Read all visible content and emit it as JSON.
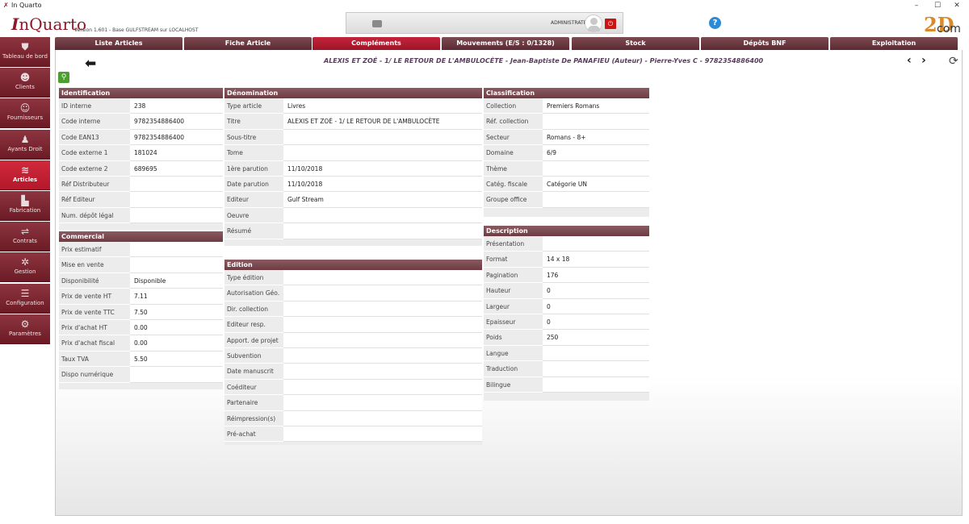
{
  "window": {
    "title": "In Quarto",
    "controls": [
      "–",
      "☐",
      "✕"
    ]
  },
  "header": {
    "logo_initial": "I",
    "logo_rest": "nQuarto",
    "version": "Version 1.601 - Base GULFSTREAM sur LOCALHOST",
    "role": "ADMINISTRATEUR",
    "help": "?",
    "brand_big": "2D",
    "brand_com": "com"
  },
  "sidebar": [
    {
      "label": "Tableau de bord",
      "icon": "shield-icon",
      "glyph": "⛊"
    },
    {
      "label": "Clients",
      "icon": "clients-icon",
      "glyph": "☻"
    },
    {
      "label": "Fournisseurs",
      "icon": "suppliers-icon",
      "glyph": "☺"
    },
    {
      "label": "Ayants Droit",
      "icon": "person-icon",
      "glyph": "♟"
    },
    {
      "label": "Articles",
      "icon": "books-icon",
      "glyph": "≋"
    },
    {
      "label": "Fabrication",
      "icon": "factory-icon",
      "glyph": "▙"
    },
    {
      "label": "Contrats",
      "icon": "handshake-icon",
      "glyph": "⇌"
    },
    {
      "label": "Gestion",
      "icon": "network-icon",
      "glyph": "✲"
    },
    {
      "label": "Configuration",
      "icon": "sliders-icon",
      "glyph": "☰"
    },
    {
      "label": "Paramètres",
      "icon": "gears-icon",
      "glyph": "⚙"
    }
  ],
  "tabs": [
    "Liste Articles",
    "Fiche Article",
    "Compléments",
    "Mouvements (E/S : 0/1328)",
    "Stock",
    "Dépôts BNF",
    "Exploitation"
  ],
  "active_tab": "Compléments",
  "record_title": "ALEXIS ET ZOÉ - 1/ LE RETOUR DE L'AMBULOCÈTE - Jean-Baptiste De PANAFIEU (Auteur) - Pierre-Yves C - 9782354886400",
  "identification": {
    "title": "Identification",
    "rows": [
      {
        "label": "ID interne",
        "value": "238"
      },
      {
        "label": "Code interne",
        "value": "9782354886400"
      },
      {
        "label": "Code EAN13",
        "value": "9782354886400"
      },
      {
        "label": "Code externe 1",
        "value": "181024"
      },
      {
        "label": "Code externe 2",
        "value": "689695"
      },
      {
        "label": "Réf Distributeur",
        "value": ""
      },
      {
        "label": "Réf Editeur",
        "value": ""
      },
      {
        "label": "Num. dépôt légal",
        "value": ""
      }
    ]
  },
  "commercial": {
    "title": "Commercial",
    "rows": [
      {
        "label": "Prix estimatif",
        "value": ""
      },
      {
        "label": "Mise en vente",
        "value": ""
      },
      {
        "label": "Disponibilité",
        "value": "Disponible"
      },
      {
        "label": "Prix de vente HT",
        "value": "7.11"
      },
      {
        "label": "Prix de vente TTC",
        "value": "7.50"
      },
      {
        "label": "Prix d'achat HT",
        "value": "0.00"
      },
      {
        "label": "Prix d'achat fiscal",
        "value": "0.00"
      },
      {
        "label": "Taux TVA",
        "value": "5.50"
      },
      {
        "label": "Dispo numérique",
        "value": ""
      }
    ]
  },
  "denomination": {
    "title": "Dénomination",
    "rows": [
      {
        "label": "Type article",
        "value": "Livres"
      },
      {
        "label": "Titre",
        "value": "ALEXIS ET ZOÉ - 1/ LE RETOUR DE L'AMBULOCÈTE"
      },
      {
        "label": "Sous-titre",
        "value": ""
      },
      {
        "label": "Tome",
        "value": ""
      },
      {
        "label": "1ère parution",
        "value": "11/10/2018"
      },
      {
        "label": "Date parution",
        "value": "11/10/2018"
      },
      {
        "label": "Editeur",
        "value": "Gulf Stream"
      },
      {
        "label": "Oeuvre",
        "value": ""
      },
      {
        "label": "Résumé",
        "value": ""
      }
    ]
  },
  "edition": {
    "title": "Edition",
    "rows": [
      {
        "label": "Type édition",
        "value": ""
      },
      {
        "label": "Autorisation Géo.",
        "value": ""
      },
      {
        "label": "Dir. collection",
        "value": ""
      },
      {
        "label": "Editeur resp.",
        "value": ""
      },
      {
        "label": "Apport. de projet",
        "value": ""
      },
      {
        "label": "Subvention",
        "value": ""
      },
      {
        "label": "Date manuscrit",
        "value": ""
      },
      {
        "label": "Coéditeur",
        "value": ""
      },
      {
        "label": "Partenaire",
        "value": ""
      },
      {
        "label": "Réimpression(s)",
        "value": ""
      },
      {
        "label": "Pré-achat",
        "value": ""
      }
    ]
  },
  "classification": {
    "title": "Classification",
    "rows": [
      {
        "label": "Collection",
        "value": "Premiers Romans"
      },
      {
        "label": "Réf. collection",
        "value": ""
      },
      {
        "label": "Secteur",
        "value": "Romans - 8+"
      },
      {
        "label": "Domaine",
        "value": "6/9"
      },
      {
        "label": "Thème",
        "value": ""
      },
      {
        "label": "Catég. fiscale",
        "value": "Catégorie UN"
      },
      {
        "label": "Groupe office",
        "value": ""
      }
    ]
  },
  "description": {
    "title": "Description",
    "rows": [
      {
        "label": "Présentation",
        "value": ""
      },
      {
        "label": "Format",
        "value": "14 x 18"
      },
      {
        "label": "Pagination",
        "value": "176"
      },
      {
        "label": "Hauteur",
        "value": "0"
      },
      {
        "label": "Largeur",
        "value": "0"
      },
      {
        "label": "Epaisseur",
        "value": "0"
      },
      {
        "label": "Poids",
        "value": "250"
      },
      {
        "label": "Langue",
        "value": ""
      },
      {
        "label": "Traduction",
        "value": ""
      },
      {
        "label": "Bilingue",
        "value": ""
      }
    ]
  }
}
